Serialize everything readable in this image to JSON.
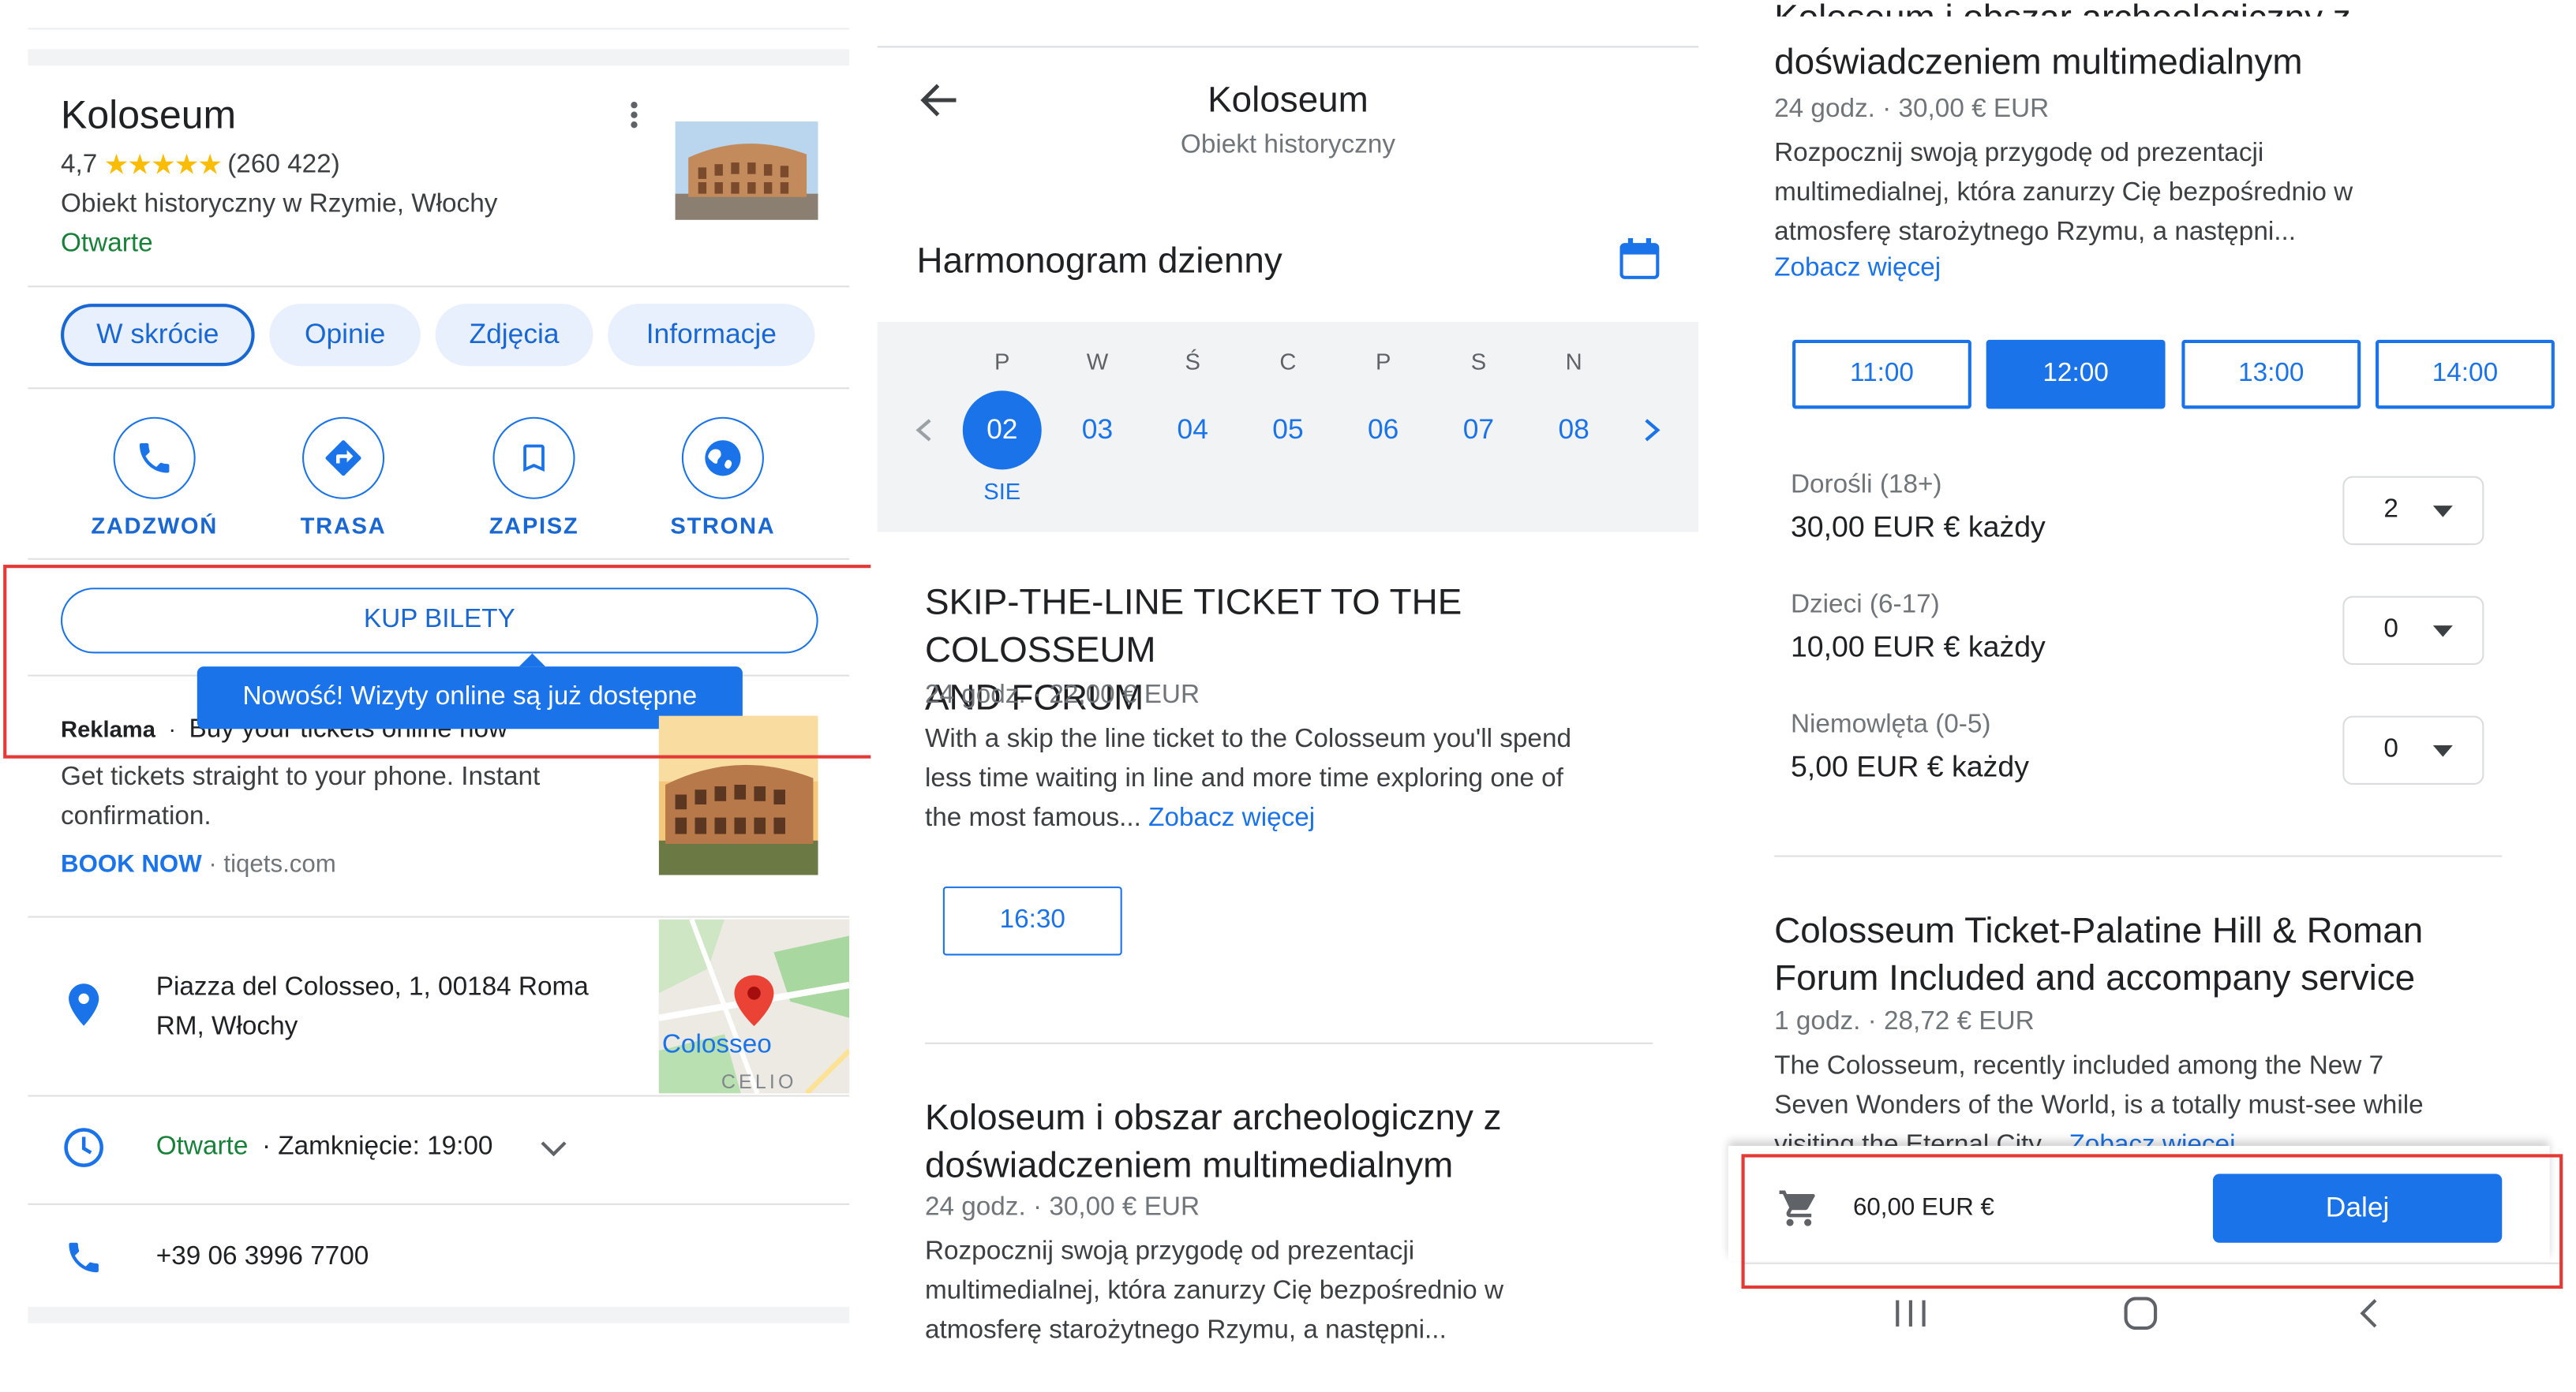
{
  "place": {
    "name": "Koloseum",
    "rating": "4,7",
    "reviews": "(260 422)",
    "category": "Obiekt historyczny w Rzymie, Włochy",
    "status": "Otwarte"
  },
  "tabs": [
    "W skrócie",
    "Opinie",
    "Zdjęcia",
    "Informacje"
  ],
  "actions": [
    {
      "label": "ZADZWOŃ",
      "icon": "phone-icon"
    },
    {
      "label": "TRASA",
      "icon": "directions-icon"
    },
    {
      "label": "ZAPISZ",
      "icon": "bookmark-icon"
    },
    {
      "label": "STRONA",
      "icon": "globe-icon"
    }
  ],
  "buy_tickets": "KUP BILETY",
  "tooltip": "Nowość! Wizyty online są już dostępne",
  "ad": {
    "badge": "Reklama",
    "headline": "Buy your tickets online now",
    "body": "Get tickets straight to your phone. Instant confirmation.",
    "cta": "BOOK NOW",
    "domain": "· tiqets.com"
  },
  "address": {
    "line1": "Piazza del Colosseo, 1, 00184 Roma",
    "line2": "RM, Włochy",
    "map_label": "Colosseo",
    "map_label2": "CELIO"
  },
  "hours": {
    "status": "Otwarte",
    "closing": "· Zamknięcie: 19:00"
  },
  "phone": "+39 06 3996 7700",
  "booking": {
    "title": "Koloseum",
    "subtitle": "Obiekt historyczny",
    "schedule_label": "Harmonogram dzienny",
    "days": [
      {
        "letter": "P",
        "num": "02",
        "selected": true
      },
      {
        "letter": "W",
        "num": "03"
      },
      {
        "letter": "Ś",
        "num": "04"
      },
      {
        "letter": "C",
        "num": "05"
      },
      {
        "letter": "P",
        "num": "06"
      },
      {
        "letter": "S",
        "num": "07"
      },
      {
        "letter": "N",
        "num": "08"
      }
    ],
    "month": "SIE",
    "tickets": [
      {
        "title_line1": "SKIP-THE-LINE TICKET TO THE COLOSSEUM",
        "title_line2": "AND FORUM",
        "meta": "24 godz. · 22,00 € EUR",
        "desc1": "With a skip the line ticket to the Colosseum you'll spend",
        "desc2": "less time waiting in line and more time exploring one of",
        "desc3": "the most famous...",
        "more": "Zobacz więcej",
        "time": "16:30"
      },
      {
        "title_line1": "Koloseum i obszar archeologiczny z",
        "title_line2": "doświadczeniem multimedialnym",
        "meta": "24 godz. · 30,00 € EUR",
        "desc1": "Rozpocznij swoją przygodę od prezentacji",
        "desc2": "multimedialnej, która zanurzy Cię bezpośrednio w",
        "desc3": "atmosferę starożytnego Rzymu, a następni...",
        "more": "Zobacz więcej"
      }
    ]
  },
  "checkout": {
    "partial_title": "Koloseum i obszar archeologiczny z",
    "times": [
      "11:00",
      "12:00",
      "13:00",
      "14:00"
    ],
    "selected_time": "12:00",
    "prices": [
      {
        "label": "Dorośli (18+)",
        "price": "30,00 EUR € każdy",
        "qty": "2"
      },
      {
        "label": "Dzieci (6-17)",
        "price": "10,00 EUR € każdy",
        "qty": "0"
      },
      {
        "label": "Niemowlęta (0-5)",
        "price": "5,00 EUR € każdy",
        "qty": "0"
      }
    ],
    "other": {
      "title_line1": "Colosseum Ticket-Palatine Hill & Roman",
      "title_line2": "Forum Included and accompany service",
      "meta": "1 godz. · 28,72 € EUR",
      "desc1": "The Colosseum, recently included among the New 7",
      "desc2": "Seven Wonders of the World, is a totally must-see while",
      "desc3": "visiting the Eternal City...",
      "more": "Zobacz więcej"
    },
    "total": "60,00 EUR €",
    "next": "Dalej"
  },
  "colors": {
    "accent": "#1a73e8",
    "highlight": "#e53935",
    "open": "#188038",
    "star": "#fbbc04"
  }
}
